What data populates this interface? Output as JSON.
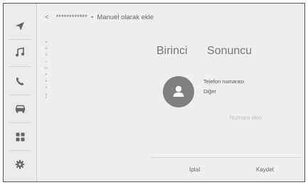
{
  "sidebar": {
    "icons": [
      "navigation-arrow-icon",
      "music-note-icon",
      "phone-icon",
      "car-icon",
      "apps-grid-icon",
      "settings-gear-icon"
    ]
  },
  "header": {
    "back_symbol": "<",
    "contact_name_masked": "************",
    "separator": "•",
    "title": "Manuel olarak ekle"
  },
  "index_letters": [
    "A",
    ":",
    "D",
    ":",
    "G",
    ":",
    "J",
    ":",
    "M",
    ":",
    "P",
    ":",
    "S",
    ":",
    "V",
    ":",
    "Z",
    "#"
  ],
  "contact": {
    "first_name": "Birinci",
    "last_name": "Sonuncu",
    "phone_label": "Telefon numarası",
    "phone_type": "Diğer",
    "add_number": "Numara ekle"
  },
  "actions": {
    "cancel": "İptal",
    "save": "Kaydet"
  },
  "colors": {
    "screen_bg": "#eeeeee",
    "icon": "#666666",
    "avatar": "#7f7f7f",
    "disabled_text": "#bdbdbd"
  }
}
